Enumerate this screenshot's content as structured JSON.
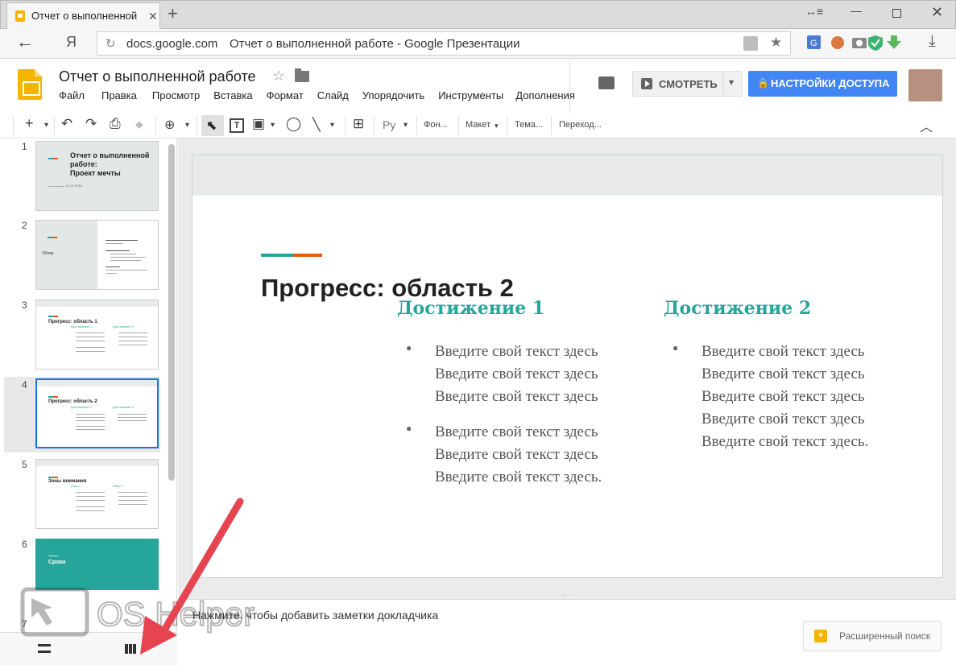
{
  "browser": {
    "tab_title": "Отчет о выполненной ра",
    "tab_close": "✕",
    "new_tab": "+",
    "window_controls": {
      "extra": "↔≡",
      "minimize": "—",
      "close": "✕"
    },
    "back": "←",
    "search_logo": "Я",
    "url_domain": "docs.google.com",
    "url_title": "Отчет о выполненной работе - Google Презентации",
    "reload_icon": "↻",
    "star_icon": "★",
    "download_icon": "⤓",
    "extension_icons": [
      "translate-icon",
      "user-extension-icon",
      "camera-icon",
      "shield-check-icon",
      "download-arrow-icon"
    ]
  },
  "docs": {
    "title": "Отчет о выполненной работе",
    "star": "☆",
    "menu": [
      "Файл",
      "Правка",
      "Просмотр",
      "Вставка",
      "Формат",
      "Слайд",
      "Упорядочить",
      "Инструменты",
      "Дополнения"
    ],
    "present_label": "СМОТРЕТЬ",
    "present_caret": "▾",
    "share_lock": "🔒",
    "share_label": "НАСТРОЙКИ ДОСТУПА"
  },
  "toolbar": {
    "new_slide": "+",
    "caret": "▾",
    "undo": "↶",
    "redo": "↷",
    "print": "⎙",
    "paint": "⬥",
    "zoom": "⊕",
    "select": "⬉",
    "textbox": "T",
    "image": "▣",
    "shape": "◯",
    "line": "╲",
    "comment": "⊞",
    "input_tools": "Ру",
    "background": "Фон...",
    "layout": "Макет",
    "theme": "Тема...",
    "transition": "Переход...",
    "collapse": "︿"
  },
  "filmstrip": {
    "slides": [
      {
        "num": "1",
        "title": "Отчет о выполненной работе: Проект мечты",
        "lines": [
          "Отчет о выполненной",
          "работе:",
          "Проект мечты"
        ],
        "date": "21.07.2016"
      },
      {
        "num": "2",
        "title": "Обзор"
      },
      {
        "num": "3",
        "title": "Прогресс: область 1",
        "col1": "Достижение 1",
        "col2": "Достижение 2"
      },
      {
        "num": "4",
        "title": "Прогресс: область 2",
        "col1": "Достижение 1",
        "col2": "Достижение 2"
      },
      {
        "num": "5",
        "title": "Зоны внимания",
        "col1": "Риск 1",
        "col2": "Риск 2"
      },
      {
        "num": "6",
        "title": "Сроки"
      },
      {
        "num": "7"
      }
    ],
    "list_view_icon": "list-view-icon",
    "grid_view_icon": "grid-view-icon"
  },
  "slide": {
    "title": "Прогресс: область 2",
    "col1_head": "Достижение 1",
    "col2_head": "Достижение 2",
    "col1_bullets": [
      [
        "Введите свой текст здесь",
        "Введите свой текст здесь",
        "Введите свой текст здесь"
      ],
      [
        "Введите свой текст здесь",
        "Введите свой текст здесь",
        "Введите свой текст здесь."
      ]
    ],
    "col2_bullets": [
      [
        "Введите свой текст здесь",
        "Введите свой текст здесь",
        "Введите свой текст здесь",
        "Введите свой текст здесь",
        "Введите свой текст здесь."
      ]
    ],
    "bullet_char": "●",
    "colors": {
      "accent_teal": "#26a69a",
      "accent_orange": "#e8590c"
    }
  },
  "notes": {
    "placeholder": "Нажмите, чтобы добавить заметки докладчика",
    "handle": "⋯"
  },
  "explore": {
    "label": "Расширенный поиск"
  },
  "watermark": {
    "text": "OS Helper"
  }
}
